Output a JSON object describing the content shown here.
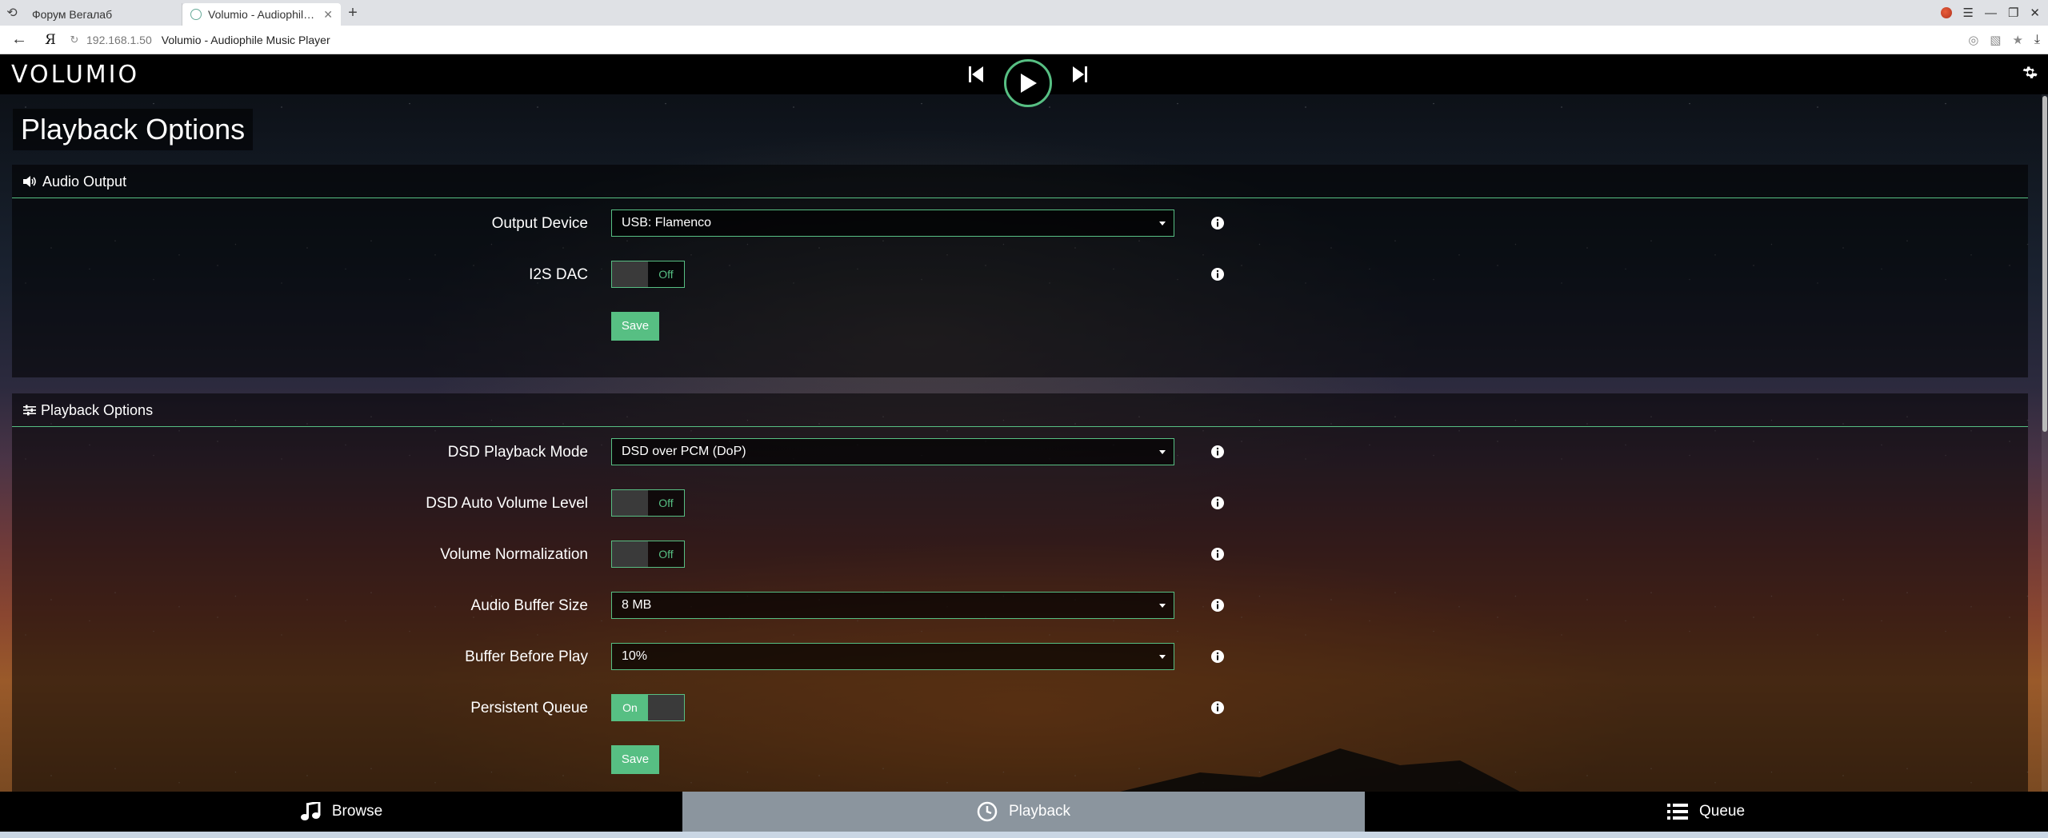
{
  "browser": {
    "tabs": [
      {
        "title": "Форум Вегалаб",
        "active": false
      },
      {
        "title": "Volumio - Audiophile Mu",
        "active": true
      }
    ],
    "address": {
      "host": "192.168.1.50",
      "page_title": "Volumio - Audiophile Music Player",
      "yandex": "Я"
    }
  },
  "app": {
    "logo": "VOLUMIO",
    "page_title": "Playback Options"
  },
  "audio_output": {
    "header": "Audio Output",
    "output_device": {
      "label": "Output Device",
      "value": "USB: Flamenco"
    },
    "i2s_dac": {
      "label": "I2S DAC",
      "state": "Off"
    },
    "save_label": "Save"
  },
  "playback_options": {
    "header": "Playback Options",
    "dsd_mode": {
      "label": "DSD Playback Mode",
      "value": "DSD over PCM (DoP)"
    },
    "dsd_auto_volume": {
      "label": "DSD Auto Volume Level",
      "state": "Off"
    },
    "volume_normalization": {
      "label": "Volume Normalization",
      "state": "Off"
    },
    "audio_buffer": {
      "label": "Audio Buffer Size",
      "value": "8 MB"
    },
    "buffer_before_play": {
      "label": "Buffer Before Play",
      "value": "10%"
    },
    "persistent_queue": {
      "label": "Persistent Queue",
      "state": "On"
    },
    "save_label": "Save"
  },
  "nav": {
    "browse": "Browse",
    "playback": "Playback",
    "queue": "Queue"
  },
  "colors": {
    "accent": "#57bf83",
    "active_nav": "#8b959e"
  }
}
